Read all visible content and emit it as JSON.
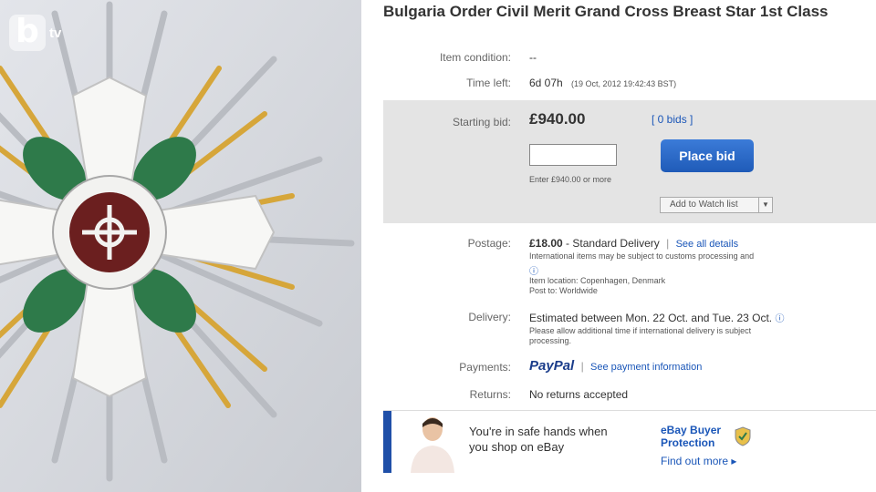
{
  "logo": {
    "letter": "b",
    "suffix": "tv"
  },
  "listing": {
    "title": "Bulgaria Order Civil Merit Grand Cross Breast Star 1st Class",
    "condition": {
      "label": "Item condition:",
      "value": "--"
    },
    "time_left": {
      "label": "Time left:",
      "value": "6d 07h",
      "date": "(19 Oct, 2012 19:42:43 BST)"
    },
    "bid": {
      "label": "Starting bid:",
      "price": "£940.00",
      "bids": "[ 0 bids ]",
      "input_placeholder": "",
      "place_bid": "Place bid",
      "hint": "Enter £940.00 or more",
      "watch": "Add to Watch list"
    },
    "postage": {
      "label": "Postage:",
      "price": "£18.00",
      "method": "- Standard Delivery",
      "details_link": "See all details",
      "note": "International items may be subject to customs processing and",
      "location": "Item location: Copenhagen, Denmark",
      "post_to": "Post to: Worldwide"
    },
    "delivery": {
      "label": "Delivery:",
      "estimate": "Estimated between Mon. 22 Oct. and Tue. 23 Oct.",
      "note1": "Please allow additional time if international delivery is subject",
      "note2": "processing."
    },
    "payments": {
      "label": "Payments:",
      "brand": "PayPal",
      "link": "See payment information"
    },
    "returns": {
      "label": "Returns:",
      "value": "No returns accepted"
    },
    "safe": {
      "line1": "You're in safe hands when",
      "line2": "you shop on eBay",
      "program1": "eBay Buyer",
      "program2": "Protection",
      "find_out": "Find out more ▸"
    }
  }
}
